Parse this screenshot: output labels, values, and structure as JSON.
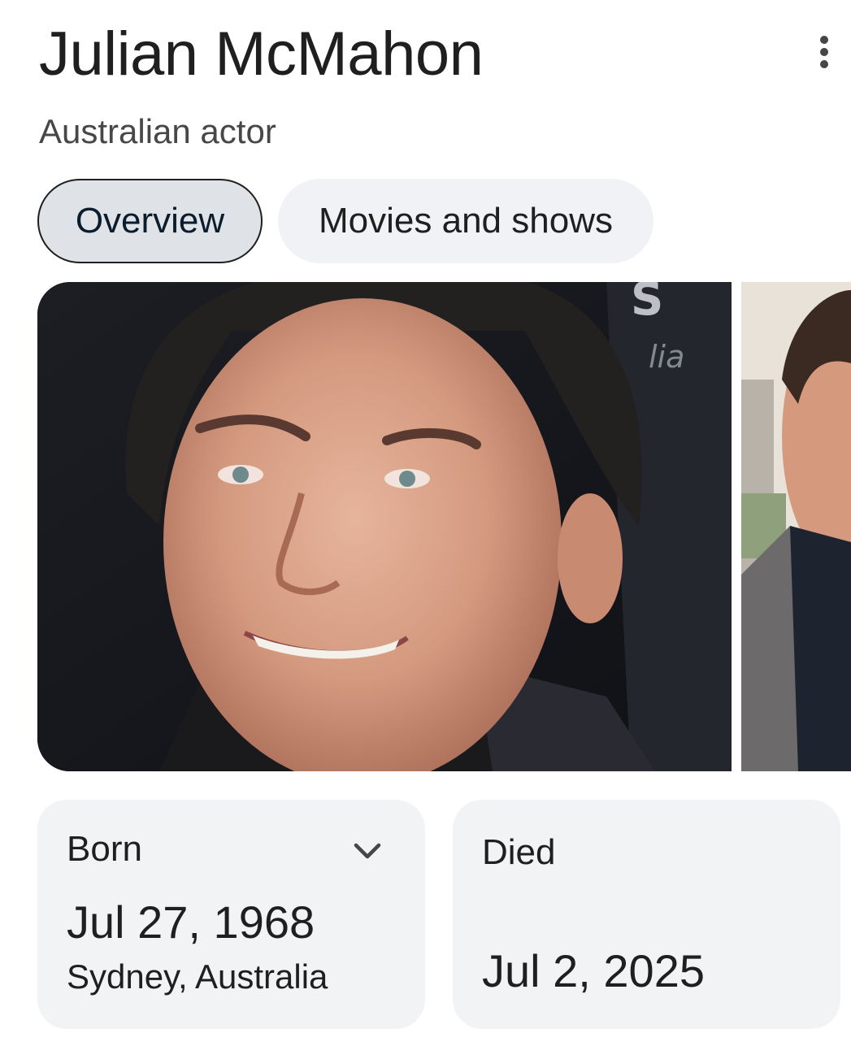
{
  "header": {
    "title": "Julian McMahon",
    "subtitle": "Australian actor",
    "more_icon": "more-vert-icon"
  },
  "tabs": [
    {
      "label": "Overview",
      "selected": true
    },
    {
      "label": "Movies and shows",
      "selected": false
    }
  ],
  "gallery": {
    "images": [
      {
        "description": "Headshot photo"
      },
      {
        "description": "Second photo"
      }
    ]
  },
  "facts": {
    "born": {
      "label": "Born",
      "date": "Jul 27, 1968",
      "place": "Sydney, Australia",
      "expand_icon": "chevron-down-icon"
    },
    "died": {
      "label": "Died",
      "date": "Jul 2, 2025"
    }
  },
  "colors": {
    "selected_tab_bg": "#dfe3e7",
    "tab_bg": "#f0f2f5",
    "card_bg": "#f2f3f5",
    "text": "#1f1f1f",
    "subtext": "#474747"
  }
}
